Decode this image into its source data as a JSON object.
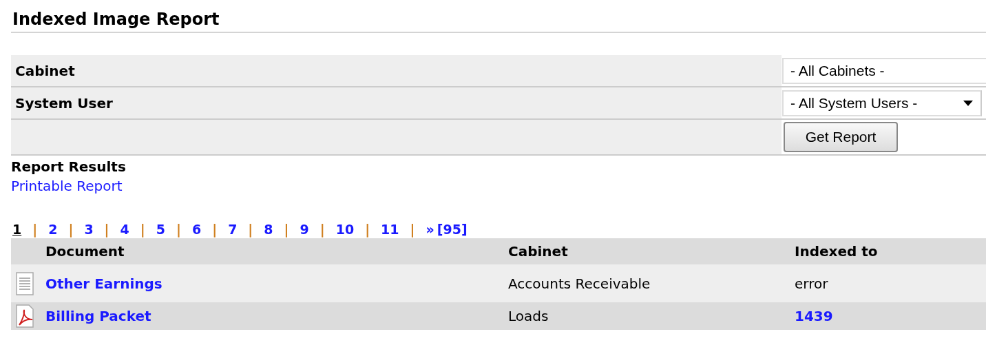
{
  "title": "Indexed Image Report",
  "filters": [
    {
      "label": "Cabinet",
      "value": "- All Cabinets -",
      "dropdown_arrow": false
    },
    {
      "label": "System User",
      "value": "- All System Users -",
      "dropdown_arrow": true
    }
  ],
  "submit_button": "Get Report",
  "results_heading": "Report Results",
  "printable_link": "Printable Report",
  "pagination": [
    {
      "kind": "page",
      "label": "1",
      "selected": true
    },
    {
      "kind": "separator",
      "label": "|"
    },
    {
      "kind": "page",
      "label": "2",
      "selected": false
    },
    {
      "kind": "separator",
      "label": "|"
    },
    {
      "kind": "page",
      "label": "3",
      "selected": false
    },
    {
      "kind": "separator",
      "label": "|"
    },
    {
      "kind": "page",
      "label": "4",
      "selected": false
    },
    {
      "kind": "separator",
      "label": "|"
    },
    {
      "kind": "page",
      "label": "5",
      "selected": false
    },
    {
      "kind": "separator",
      "label": "|"
    },
    {
      "kind": "page",
      "label": "6",
      "selected": false
    },
    {
      "kind": "separator",
      "label": "|"
    },
    {
      "kind": "page",
      "label": "7",
      "selected": false
    },
    {
      "kind": "separator",
      "label": "|"
    },
    {
      "kind": "page",
      "label": "8",
      "selected": false
    },
    {
      "kind": "separator",
      "label": "|"
    },
    {
      "kind": "page",
      "label": "9",
      "selected": false
    },
    {
      "kind": "separator",
      "label": "|"
    },
    {
      "kind": "page",
      "label": "10",
      "selected": false
    },
    {
      "kind": "separator",
      "label": "|"
    },
    {
      "kind": "page",
      "label": "11",
      "selected": false
    },
    {
      "kind": "separator",
      "label": "|"
    },
    {
      "kind": "page",
      "label": "»",
      "selected": false
    },
    {
      "kind": "page",
      "label": "[95]",
      "selected": false
    }
  ],
  "table": {
    "columns": [
      "Document",
      "Cabinet",
      "Indexed to"
    ],
    "rows": [
      {
        "kind": "text",
        "document": "Other Earnings",
        "cabinet": "Accounts Receivable",
        "indexed_to": {
          "kind": "text",
          "label": "error"
        }
      },
      {
        "kind": "pdf",
        "document": "Billing Packet",
        "cabinet": "Loads",
        "indexed_to": {
          "kind": "link",
          "label": "1439"
        }
      }
    ]
  }
}
